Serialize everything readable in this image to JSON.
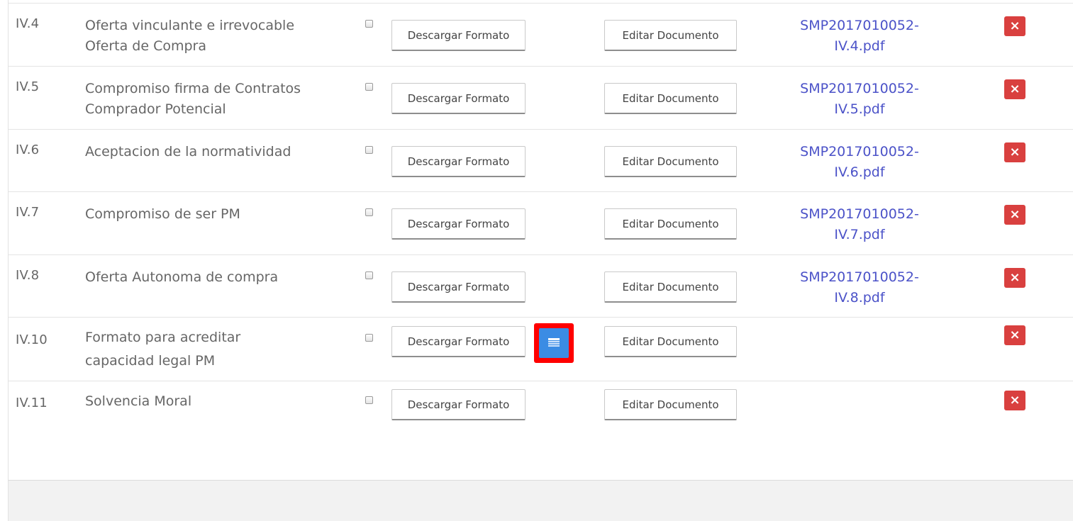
{
  "rows": [
    {
      "code": "IV.4",
      "name_line1": "Oferta vinculante e irrevocable",
      "name_line2": "Oferta de Compra",
      "download_label": "Descargar Formato",
      "edit_label": "Editar Documento",
      "file_line1": "SMP2017010052-",
      "file_line2": "IV.4.pdf",
      "delete_icon": "×"
    },
    {
      "code": "IV.5",
      "name_line1": "Compromiso firma de Contratos",
      "name_line2": "Comprador Potencial",
      "download_label": "Descargar Formato",
      "edit_label": "Editar Documento",
      "file_line1": "SMP2017010052-",
      "file_line2": "IV.5.pdf",
      "delete_icon": "×"
    },
    {
      "code": "IV.6",
      "name_line1": "Aceptacion de la normatividad",
      "name_line2": "",
      "download_label": "Descargar Formato",
      "edit_label": "Editar Documento",
      "file_line1": "SMP2017010052-",
      "file_line2": "IV.6.pdf",
      "delete_icon": "×"
    },
    {
      "code": "IV.7",
      "name_line1": "Compromiso de ser PM",
      "name_line2": "",
      "download_label": "Descargar Formato",
      "edit_label": "Editar Documento",
      "file_line1": "SMP2017010052-",
      "file_line2": "IV.7.pdf",
      "delete_icon": "×"
    },
    {
      "code": "IV.8",
      "name_line1": "Oferta Autonoma de compra",
      "name_line2": "",
      "download_label": "Descargar Formato",
      "edit_label": "Editar Documento",
      "file_line1": "SMP2017010052-",
      "file_line2": "IV.8.pdf",
      "delete_icon": "×"
    },
    {
      "code": "IV.10",
      "name_line1": "Formato para acreditar",
      "name_line2": "capacidad legal PM",
      "download_label": "Descargar Formato",
      "edit_label": "Editar Documento",
      "file_line1": "",
      "file_line2": "",
      "delete_icon": "×",
      "extra_icon": "list-icon"
    },
    {
      "code": "IV.11",
      "name_line1": "Solvencia Moral",
      "name_line2": "",
      "download_label": "Descargar Formato",
      "edit_label": "Editar Documento",
      "file_line1": "",
      "file_line2": "",
      "delete_icon": "×"
    }
  ],
  "colors": {
    "link": "#4b52c8",
    "delete": "#d9403f",
    "highlight": "#ff0000",
    "list_button": "#3b8ce4"
  }
}
